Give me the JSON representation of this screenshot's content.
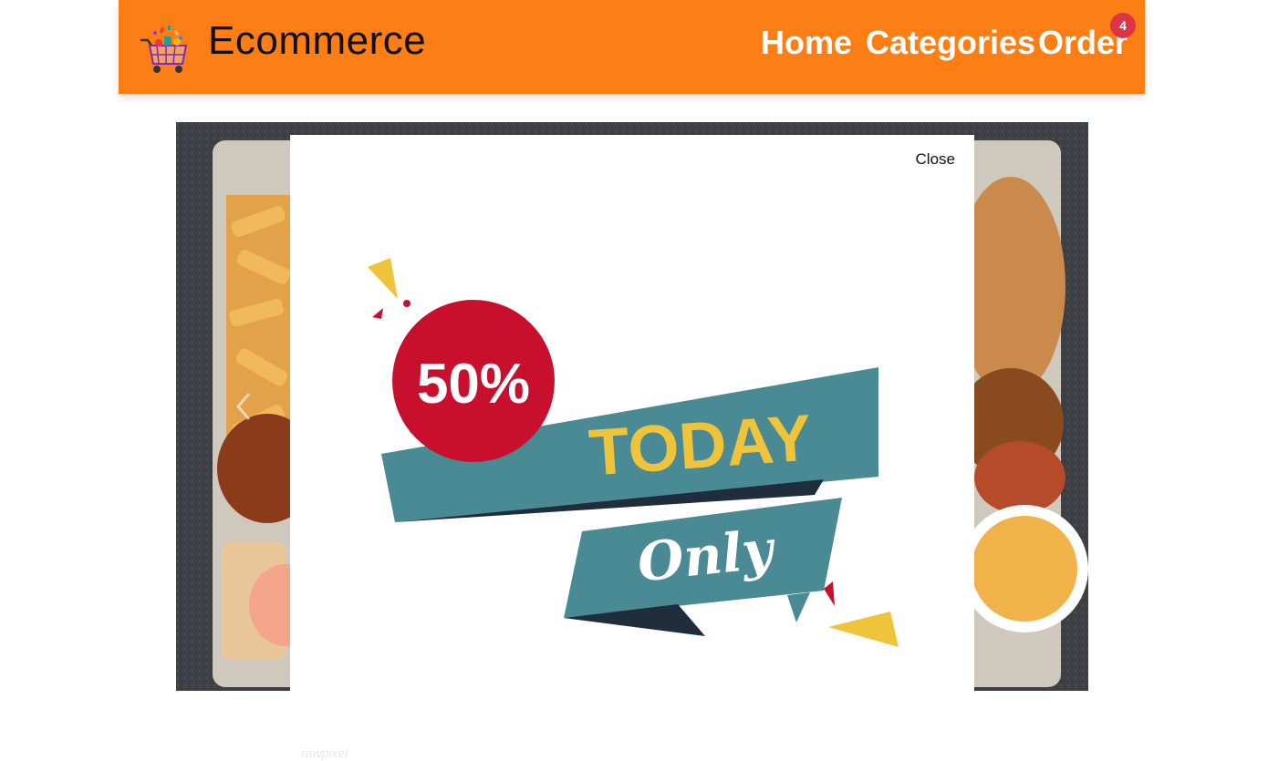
{
  "navbar": {
    "brand_name": "Ecommerce",
    "brand_logo_icon": "shopping-cart-icon",
    "links": {
      "home": "Home",
      "categories": "Categories",
      "order": "Order"
    },
    "order_badge": "4",
    "colors": {
      "navbar_bg": "#fd7e14",
      "badge_bg": "#dc3545"
    }
  },
  "carousel": {
    "prev_icon": "chevron-left-icon"
  },
  "modal": {
    "close_label": "Close",
    "promo": {
      "discount": "50%",
      "headline": "TODAY",
      "tagline": "Only",
      "colors": {
        "circle": "#c8102e",
        "ribbon": "#4a8a95",
        "ribbon_dark": "#1f2d3d",
        "accent": "#f0c43a"
      }
    }
  },
  "footer": {
    "watermark": "rawpixel"
  }
}
